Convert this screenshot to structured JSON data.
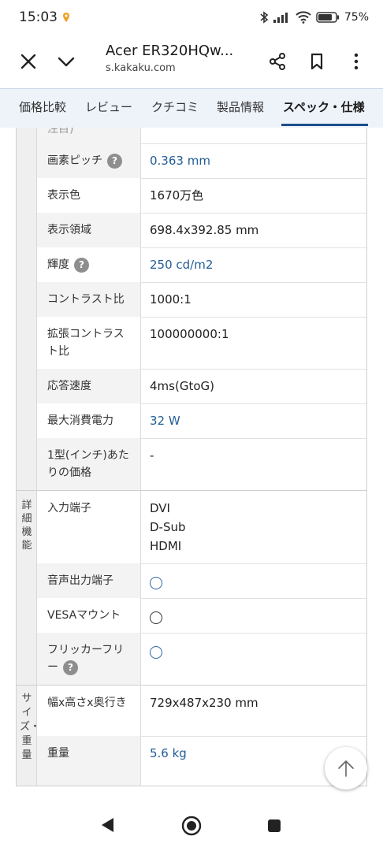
{
  "status": {
    "time": "15:03",
    "battery": "75%"
  },
  "appbar": {
    "title": "Acer ER320HQw...",
    "url": "s.kakaku.com"
  },
  "tabs": [
    {
      "label": "価格比較"
    },
    {
      "label": "レビュー"
    },
    {
      "label": "クチコミ"
    },
    {
      "label": "製品情報"
    },
    {
      "label": "スペック・仕様"
    }
  ],
  "spec": {
    "partial_label": "注目)",
    "rows": [
      {
        "label": "画素ピッチ",
        "value": "0.363 mm"
      },
      {
        "label": "表示色",
        "value": "1670万色"
      },
      {
        "label": "表示領域",
        "value": "698.4x392.85 mm"
      },
      {
        "label": "輝度",
        "value": "250 cd/m2"
      },
      {
        "label": "コントラスト比",
        "value": "1000:1"
      },
      {
        "label": "拡張コントラスト比",
        "value": "100000000:1"
      },
      {
        "label": "応答速度",
        "value": "4ms(GtoG)"
      },
      {
        "label": "最大消費電力",
        "value": "32 W"
      },
      {
        "label": "1型(インチ)あたりの価格",
        "value": "-"
      }
    ],
    "detail": {
      "category": "詳細機能",
      "rows": [
        {
          "label": "入力端子",
          "values": [
            "DVI",
            "D-Sub",
            "HDMI"
          ]
        },
        {
          "label": "音声出力端子",
          "value": "○"
        },
        {
          "label": "VESAマウント",
          "value": "○"
        },
        {
          "label": "フリッカーフリー",
          "value": "○"
        }
      ]
    },
    "size": {
      "category": "サイズ・重量",
      "rows": [
        {
          "label": "幅x高さx奥行き",
          "value": "729x487x230 mm"
        },
        {
          "label": "重量",
          "value": "5.6 kg"
        }
      ]
    }
  }
}
